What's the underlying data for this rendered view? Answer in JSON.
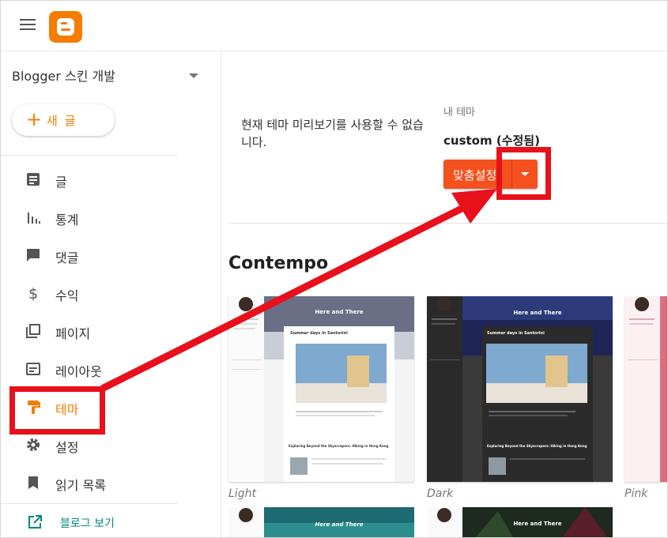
{
  "app": {
    "brand_color": "#f57d00",
    "logo_icon": "blogger-logo-icon"
  },
  "sidebar": {
    "blog_name": "Blogger 스킨 개발",
    "new_post_label": "새 글",
    "items": [
      {
        "label": "글",
        "icon": "posts-icon"
      },
      {
        "label": "통계",
        "icon": "stats-icon"
      },
      {
        "label": "댓글",
        "icon": "comments-icon"
      },
      {
        "label": "수익",
        "icon": "earnings-icon"
      },
      {
        "label": "페이지",
        "icon": "pages-icon"
      },
      {
        "label": "레이아웃",
        "icon": "layout-icon"
      },
      {
        "label": "테마",
        "icon": "theme-icon",
        "active": true
      },
      {
        "label": "설정",
        "icon": "settings-icon"
      },
      {
        "label": "읽기 목록",
        "icon": "reading-list-icon"
      }
    ],
    "view_blog_label": "블로그 보기"
  },
  "main": {
    "preview_message": "현재 테마 미리보기를 사용할 수 없습니다.",
    "my_theme_label": "내 테마",
    "my_theme_name": "custom (수정됨)",
    "customize_label": "맞춤설정",
    "accent_color": "#f4511e",
    "section_title": "Contempo",
    "themes": [
      {
        "name": "Light",
        "header_title": "Here and There",
        "post1_title": "Summer days in Santorini",
        "post2_title": "Exploring Beyond the Skyscrapers: Hiking in Hong Kong"
      },
      {
        "name": "Dark",
        "header_title": "Here and There",
        "post1_title": "Summer days in Santorini",
        "post2_title": "Exploring Beyond the Skyscrapers: Hiking in Hong Kong"
      },
      {
        "name": "Pink"
      }
    ],
    "second_row": [
      {
        "header_title": "Here and There"
      },
      {
        "header_title": "Here and There"
      }
    ]
  },
  "annotation": {
    "color": "#e8101a"
  }
}
